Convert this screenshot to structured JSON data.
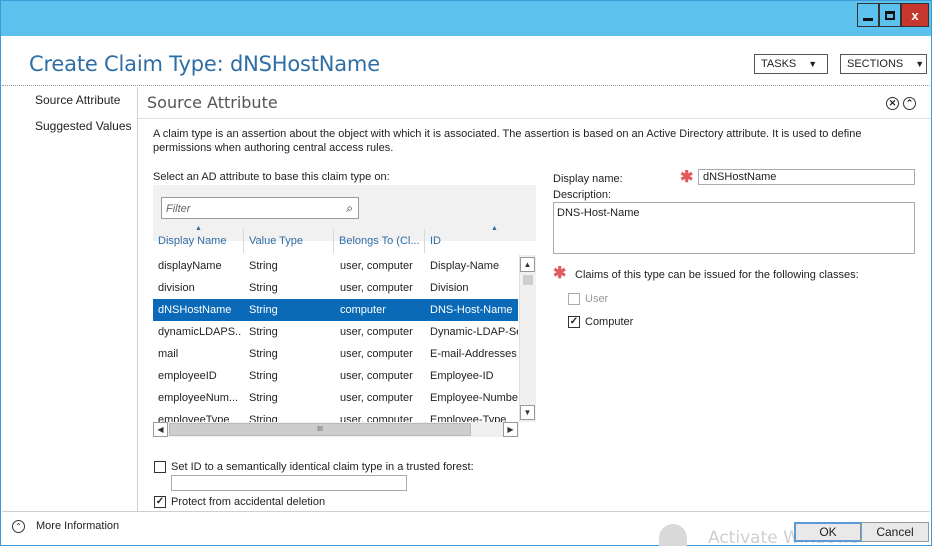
{
  "window": {
    "close_glyph": "x"
  },
  "header": {
    "title": "Create Claim Type: dNSHostName",
    "tasks_label": "TASKS",
    "sections_label": "SECTIONS"
  },
  "nav": {
    "items": [
      {
        "label": "Source Attribute"
      },
      {
        "label": "Suggested Values"
      }
    ]
  },
  "section": {
    "title": "Source Attribute",
    "intro": "A claim type is an assertion about the object with which it is associated. The assertion is based on an Active Directory attribute. It is used to define permissions when authoring central access rules.",
    "select_label": "Select an AD attribute to base this claim type on:"
  },
  "filter": {
    "placeholder": "Filter"
  },
  "table": {
    "columns": [
      "Display Name",
      "Value Type",
      "Belongs To (Cl...",
      "ID"
    ],
    "rows": [
      [
        "displayName",
        "String",
        "user, computer",
        "Display-Name"
      ],
      [
        "division",
        "String",
        "user, computer",
        "Division"
      ],
      [
        "dNSHostName",
        "String",
        "computer",
        "DNS-Host-Name"
      ],
      [
        "dynamicLDAPS...",
        "String",
        "user, computer",
        "Dynamic-LDAP-Ser"
      ],
      [
        "mail",
        "String",
        "user, computer",
        "E-mail-Addresses"
      ],
      [
        "employeeID",
        "String",
        "user, computer",
        "Employee-ID"
      ],
      [
        "employeeNum...",
        "String",
        "user, computer",
        "Employee-Number"
      ],
      [
        "employeeType",
        "String",
        "user, computer",
        "Employee-Type"
      ]
    ],
    "selected_row": 2,
    "scroll_thumb_glyph": "III"
  },
  "form": {
    "display_name_label": "Display name:",
    "display_name_value": "dNSHostName",
    "description_label": "Description:",
    "description_value": "DNS-Host-Name",
    "classes_label": "Claims of this type can be issued for the following classes:",
    "class_user_label": "User",
    "class_user_checked": false,
    "class_computer_label": "Computer",
    "class_computer_checked": true,
    "set_id_label": "Set ID to a semantically identical claim type in a trusted forest:",
    "set_id_checked": false,
    "protect_label": "Protect from accidental deletion",
    "protect_checked": true
  },
  "footer": {
    "more_info_label": "More Information",
    "ok_label": "OK",
    "cancel_label": "Cancel",
    "watermark": "Activate Windows"
  },
  "colors": {
    "titlebar": "#5dc1ed",
    "accent": "#2f6da5",
    "selection": "#0a6ab7",
    "required": "#e05b5b"
  }
}
